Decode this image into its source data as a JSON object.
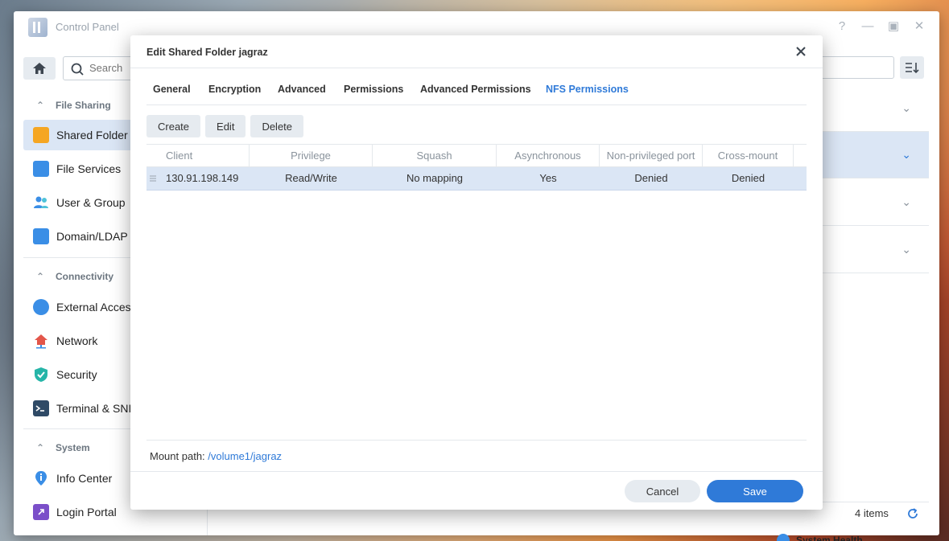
{
  "window": {
    "title": "Control Panel",
    "controls": [
      "help-icon",
      "minimize-icon",
      "maximize-icon",
      "close-icon"
    ]
  },
  "sidebar": {
    "search_placeholder": "Search",
    "sections": [
      {
        "label": "File Sharing",
        "items": [
          {
            "label": "Shared Folder",
            "icon": "shared-folder-icon",
            "active": true
          },
          {
            "label": "File Services",
            "icon": "file-services-icon"
          },
          {
            "label": "User & Group",
            "icon": "user-group-icon"
          },
          {
            "label": "Domain/LDAP",
            "icon": "domain-ldap-icon"
          }
        ]
      },
      {
        "label": "Connectivity",
        "items": [
          {
            "label": "External Acces",
            "icon": "external-access-icon"
          },
          {
            "label": "Network",
            "icon": "network-icon"
          },
          {
            "label": "Security",
            "icon": "security-shield-icon"
          },
          {
            "label": "Terminal & SNI",
            "icon": "terminal-icon"
          }
        ]
      },
      {
        "label": "System",
        "items": [
          {
            "label": "Info Center",
            "icon": "info-center-icon"
          },
          {
            "label": "Login Portal",
            "icon": "login-portal-icon"
          }
        ]
      }
    ]
  },
  "main": {
    "items_count": "4 items",
    "system_health": "System Health"
  },
  "dialog": {
    "title": "Edit Shared Folder jagraz",
    "tabs": [
      {
        "label": "General"
      },
      {
        "label": "Encryption"
      },
      {
        "label": "Advanced"
      },
      {
        "label": "Permissions"
      },
      {
        "label": "Advanced Permissions"
      },
      {
        "label": "NFS Permissions",
        "active": true
      }
    ],
    "toolbar": {
      "create": "Create",
      "edit": "Edit",
      "delete": "Delete"
    },
    "columns": [
      "Client",
      "Privilege",
      "Squash",
      "Asynchronous",
      "Non-privileged port",
      "Cross-mount"
    ],
    "rows": [
      {
        "client": "130.91.198.149",
        "privilege": "Read/Write",
        "squash": "No mapping",
        "asynchronous": "Yes",
        "non_privileged_port": "Denied",
        "cross_mount": "Denied"
      }
    ],
    "mount_label": "Mount path:",
    "mount_path": "/volume1/jagraz",
    "cancel": "Cancel",
    "save": "Save"
  }
}
